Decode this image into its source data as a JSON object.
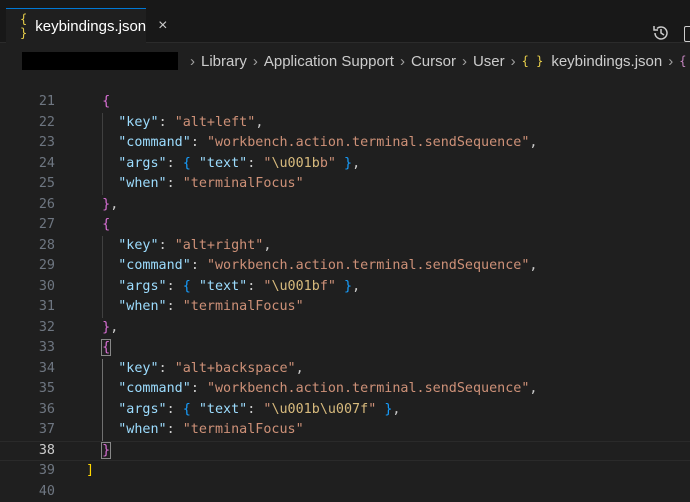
{
  "tab": {
    "icon": "{ }",
    "label": "keybindings.json",
    "close": "×"
  },
  "breadcrumb": {
    "items": [
      "Library",
      "Application Support",
      "Cursor",
      "User"
    ],
    "file_icon": "{ }",
    "file": "keybindings.json",
    "trailing_icon": "{"
  },
  "editor": {
    "current_line": 38,
    "lines": [
      {
        "n": "21"
      },
      {
        "n": "22"
      },
      {
        "n": "23"
      },
      {
        "n": "24"
      },
      {
        "n": "25"
      },
      {
        "n": "26"
      },
      {
        "n": "27"
      },
      {
        "n": "28"
      },
      {
        "n": "29"
      },
      {
        "n": "30"
      },
      {
        "n": "31"
      },
      {
        "n": "32"
      },
      {
        "n": "33"
      },
      {
        "n": "34"
      },
      {
        "n": "35"
      },
      {
        "n": "36"
      },
      {
        "n": "37"
      },
      {
        "n": "38"
      },
      {
        "n": "39"
      },
      {
        "n": "40"
      }
    ],
    "bindings": [
      {
        "key": "\"alt+left\"",
        "command": "\"workbench.action.terminal.sendSequence\"",
        "text": "\\u001bb",
        "when": "\"terminalFocus\""
      },
      {
        "key": "\"alt+right\"",
        "command": "\"workbench.action.terminal.sendSequence\"",
        "text": "\\u001bf",
        "when": "\"terminalFocus\""
      },
      {
        "key": "\"alt+backspace\"",
        "command": "\"workbench.action.terminal.sendSequence\"",
        "text": "\\u001b\\u007f",
        "when": "\"terminalFocus\""
      }
    ],
    "tokens": {
      "key": "\"key\"",
      "command": "\"command\"",
      "args": "\"args\"",
      "text": "\"text\"",
      "when": "\"when\""
    }
  }
}
